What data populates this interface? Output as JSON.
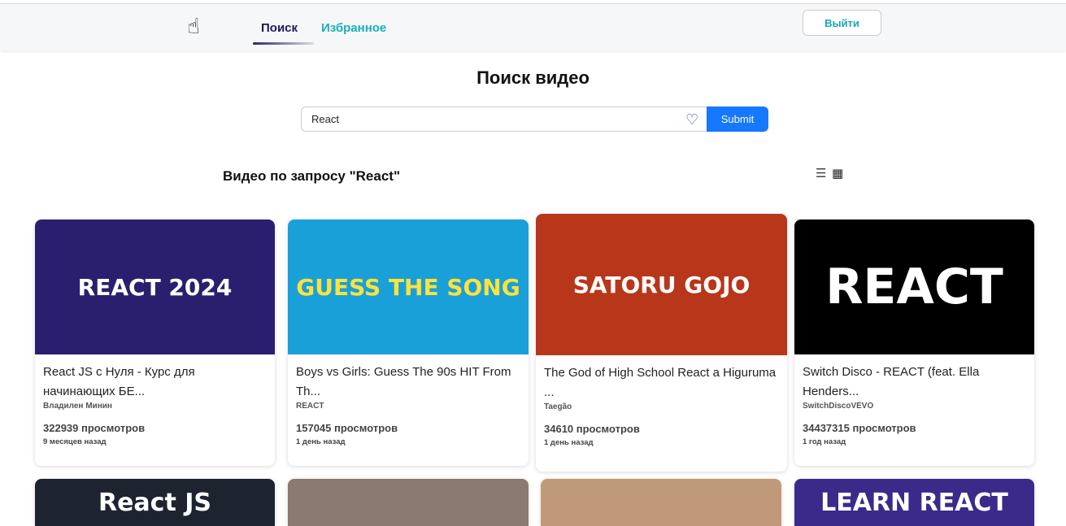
{
  "header": {
    "logo_icon": "hand-pointer-icon",
    "tabs": [
      {
        "label": "Поиск",
        "active": true
      },
      {
        "label": "Избранное",
        "active": false
      }
    ],
    "logout": "Выйти"
  },
  "page_title": "Поиск видео",
  "search": {
    "value": "React",
    "favorite_icon": "heart-icon",
    "submit": "Submit"
  },
  "results": {
    "title": "Видео по запросу \"React\"",
    "view_modes": [
      "list-icon",
      "grid-icon"
    ]
  },
  "videos": [
    {
      "title": "React JS с Нуля - Курс для начинающих БЕ...",
      "channel": "Владилен Минин",
      "views": "322939 просмотров",
      "ago": "9 месяцев назад",
      "thumb_text": "REACT 2024",
      "thumb_bg": "#2a1f6e"
    },
    {
      "title": "Boys vs Girls: Guess The 90s HIT From Th...",
      "channel": "REACT",
      "views": "157045 просмотров",
      "ago": "1 день назад",
      "thumb_text": "GUESS THE SONG",
      "thumb_bg": "#1aa0d8"
    },
    {
      "title": "The God of High School React a Higuruma ...",
      "channel": "Taegão",
      "views": "34610 просмотров",
      "ago": "1 день назад",
      "thumb_text": "SATORU GOJO",
      "thumb_bg": "#b8361a"
    },
    {
      "title": "Switch Disco - REACT (feat. Ella Henders...",
      "channel": "SwitchDiscoVEVO",
      "views": "34437315 просмотров",
      "ago": "1 год назад",
      "thumb_text": "REACT",
      "thumb_bg": "#000000"
    },
    {
      "thumb_text": "React JS",
      "thumb_bg": "#1d2430"
    },
    {
      "thumb_text": "",
      "thumb_bg": "#8a7a70"
    },
    {
      "thumb_text": "",
      "thumb_bg": "#c09a78"
    },
    {
      "thumb_text": "LEARN REACT",
      "thumb_bg": "#3b2a8a"
    }
  ]
}
